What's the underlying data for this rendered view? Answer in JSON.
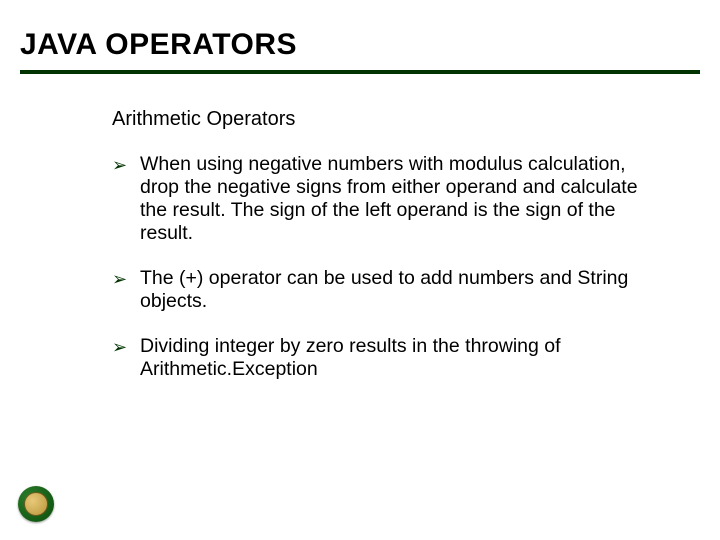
{
  "title": "JAVA OPERATORS",
  "section_heading": "Arithmetic Operators",
  "bullets": [
    "When using negative numbers with modulus calculation, drop the negative signs from either operand and calculate the result. The sign of the left operand is the sign of the result.",
    " The (+) operator can be used to add numbers and String objects.",
    " Dividing integer by zero results in the throwing of Arithmetic.Exception"
  ],
  "icons": {
    "bullet_arrow": "➢"
  }
}
